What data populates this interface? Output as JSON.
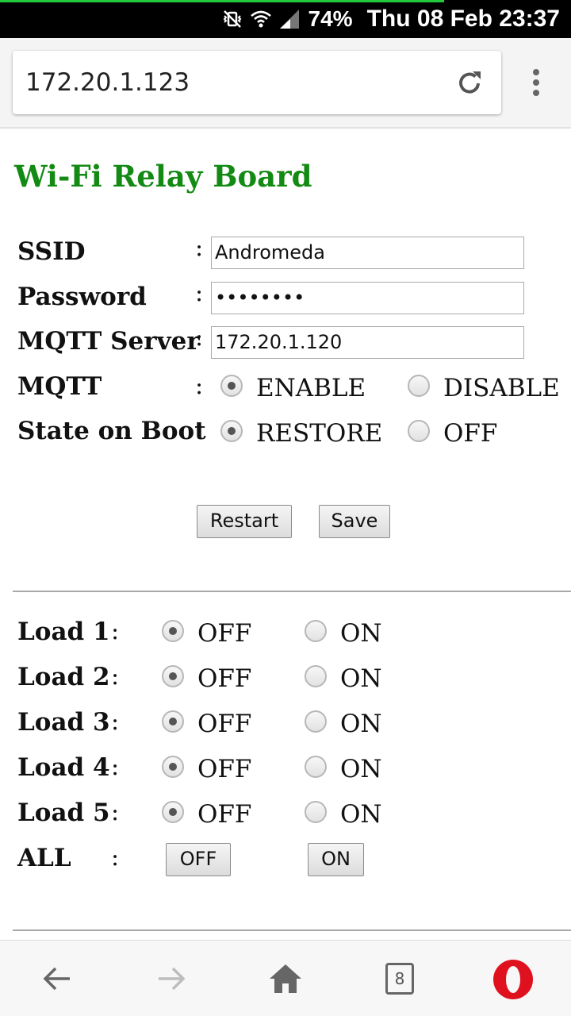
{
  "status_bar": {
    "battery": "74%",
    "datetime": "Thu 08 Feb 23:37",
    "icons": [
      "mute-vibrate-icon",
      "wifi-icon",
      "signal-icon"
    ]
  },
  "browser": {
    "url": "172.20.1.123",
    "reload_icon": "reload-icon",
    "menu_icon": "more-vert-icon"
  },
  "page": {
    "title": "Wi-Fi Relay Board",
    "title_color": "#138a13",
    "colon": ":",
    "config": {
      "ssid": {
        "label": "SSID",
        "value": "Andromeda"
      },
      "password": {
        "label": "Password",
        "value": "••••••••"
      },
      "mqtt_server": {
        "label": "MQTT Server",
        "value": "172.20.1.120"
      },
      "mqtt": {
        "label": "MQTT",
        "options": [
          "ENABLE",
          "DISABLE"
        ],
        "selected": "ENABLE"
      },
      "state_on_boot": {
        "label": "State on Boot",
        "options": [
          "RESTORE",
          "OFF"
        ],
        "selected": "RESTORE"
      }
    },
    "buttons": {
      "restart": "Restart",
      "save": "Save"
    },
    "loads": [
      {
        "label": "Load 1",
        "off": "OFF",
        "on": "ON",
        "selected": "OFF"
      },
      {
        "label": "Load 2",
        "off": "OFF",
        "on": "ON",
        "selected": "OFF"
      },
      {
        "label": "Load 3",
        "off": "OFF",
        "on": "ON",
        "selected": "OFF"
      },
      {
        "label": "Load 4",
        "off": "OFF",
        "on": "ON",
        "selected": "OFF"
      },
      {
        "label": "Load 5",
        "off": "OFF",
        "on": "ON",
        "selected": "OFF"
      }
    ],
    "all": {
      "label": "ALL",
      "off_button": "OFF",
      "on_button": "ON"
    }
  },
  "bottom_nav": {
    "tabs_count": "8",
    "icons": [
      "back-arrow-icon",
      "forward-arrow-icon",
      "home-icon",
      "tabs-icon",
      "opera-logo-icon"
    ]
  }
}
